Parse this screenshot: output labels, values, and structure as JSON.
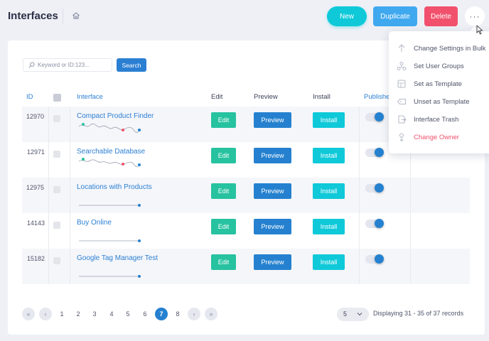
{
  "header": {
    "title": "Interfaces",
    "new_label": "New",
    "duplicate_label": "Duplicate",
    "delete_label": "Delete",
    "more_label": "···"
  },
  "search": {
    "placeholder": "Keyword or ID:123...",
    "button_label": "Search"
  },
  "table": {
    "columns": [
      "ID",
      "Interface",
      "Edit",
      "Preview",
      "Install",
      "Published"
    ],
    "rows": [
      {
        "id": "12970",
        "name": "Compact Product Finder",
        "edit": "Edit",
        "preview": "Preview",
        "install": "Install",
        "published": true
      },
      {
        "id": "12971",
        "name": "Searchable Database",
        "edit": "Edit",
        "preview": "Preview",
        "install": "Install",
        "published": true
      },
      {
        "id": "12975",
        "name": "Locations with Products",
        "edit": "Edit",
        "preview": "Preview",
        "install": "Install",
        "published": true
      },
      {
        "id": "14143",
        "name": "Buy Online",
        "edit": "Edit",
        "preview": "Preview",
        "install": "Install",
        "published": true
      },
      {
        "id": "15182",
        "name": "Google Tag Manager Test",
        "edit": "Edit",
        "preview": "Preview",
        "install": "Install",
        "published": true
      }
    ]
  },
  "pagination": {
    "first": "«",
    "prev": "‹",
    "pages": [
      "1",
      "2",
      "3",
      "4",
      "5",
      "6",
      "7",
      "8"
    ],
    "current": "7",
    "next": "›",
    "last": "»",
    "per_page": "5",
    "records_text": "Displaying 31 - 35 of 37 records"
  },
  "menu": {
    "items": [
      {
        "label": "Change Settings in Bulk",
        "icon": "arrow-up-icon",
        "danger": false
      },
      {
        "label": "Set User Groups",
        "icon": "user-groups-icon",
        "danger": false
      },
      {
        "label": "Set as Template",
        "icon": "template-icon",
        "danger": false
      },
      {
        "label": "Unset as Template",
        "icon": "tag-icon",
        "danger": false
      },
      {
        "label": "Interface Trash",
        "icon": "trash-icon",
        "danger": false
      },
      {
        "label": "Change Owner",
        "icon": "owner-icon",
        "danger": true
      }
    ]
  },
  "colors": {
    "accent": "#2581cf",
    "new": "#0fc9d9",
    "duplicate": "#3fa8ef",
    "delete": "#f1516c",
    "edit": "#27c2a0",
    "install": "#0fc9d9"
  }
}
